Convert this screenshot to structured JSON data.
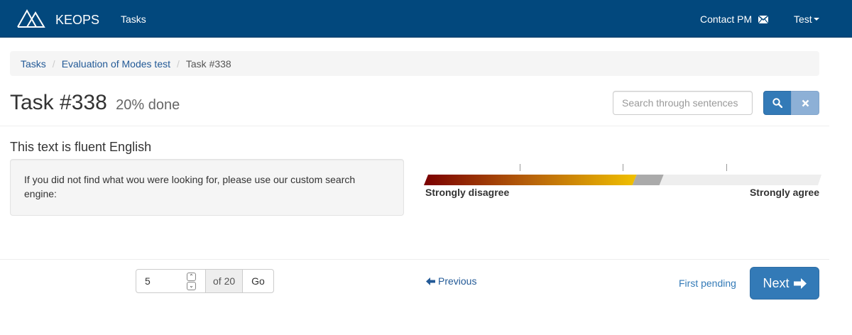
{
  "navbar": {
    "brand": "KEOPS",
    "tasks_label": "Tasks",
    "contact_label": "Contact PM",
    "user_label": "Test",
    "background": "#02487d"
  },
  "breadcrumb": {
    "items": [
      "Tasks",
      "Evaluation of Modes test",
      "Task #338"
    ]
  },
  "heading": {
    "title": "Task #338",
    "progress": "20% done"
  },
  "search": {
    "placeholder": "Search through sentences"
  },
  "question": {
    "text": "This text is fluent English",
    "sentence": "If you did not find what wou were looking for, please use our custom search engine:"
  },
  "rating": {
    "left_label": "Strongly disagree",
    "right_label": "Strongly agree",
    "value_fraction": 0.53
  },
  "pagination": {
    "current_page": "5",
    "of_label": "of 20",
    "go_label": "Go",
    "previous_label": "Previous",
    "first_pending_label": "First pending",
    "next_label": "Next"
  },
  "colors": {
    "accent": "#337ab7",
    "link": "#235a97"
  }
}
